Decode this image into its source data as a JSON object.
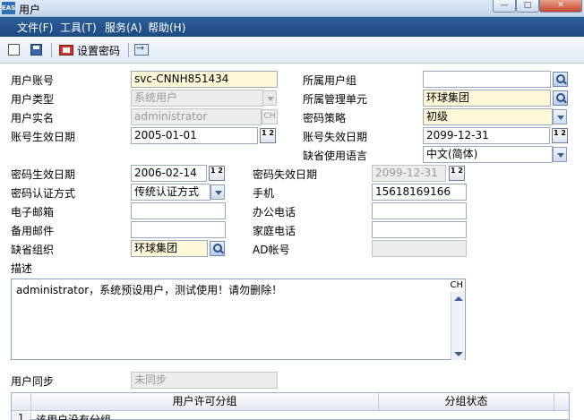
{
  "window": {
    "title": "用户",
    "logo": "EAS",
    "controls": {
      "minimize": "—",
      "maximize": "□",
      "close": "✕"
    }
  },
  "menu": {
    "items": [
      "文件(F)",
      "工具(T)",
      "服务(A)",
      "帮助(H)"
    ]
  },
  "toolbar": {
    "set_password": "设置密码"
  },
  "form": {
    "user_account": {
      "label": "用户账号",
      "value": "svc-CNNH851434"
    },
    "user_type": {
      "label": "用户类型",
      "value": "系统用户"
    },
    "real_name": {
      "label": "用户实名",
      "value": "administrator",
      "ch": "CH"
    },
    "account_effective": {
      "label": "账号生效日期",
      "value": "2005-01-01"
    },
    "user_group": {
      "label": "所属用户组",
      "value": ""
    },
    "admin_unit": {
      "label": "所属管理单元",
      "value": "环球集团"
    },
    "password_policy": {
      "label": "密码策略",
      "value": "初级"
    },
    "account_expire": {
      "label": "账号失效日期",
      "value": "2099-12-31"
    },
    "default_language": {
      "label": "缺省使用语言",
      "value": "中文(简体)"
    },
    "pwd_effective": {
      "label": "密码生效日期",
      "value": "2006-02-14"
    },
    "pwd_auth": {
      "label": "密码认证方式",
      "value": "传统认证方式"
    },
    "email": {
      "label": "电子邮箱",
      "value": ""
    },
    "backup_email": {
      "label": "备用邮件",
      "value": ""
    },
    "default_org": {
      "label": "缺省组织",
      "value": "环球集团"
    },
    "pwd_expire": {
      "label": "密码失效日期",
      "value": "2099-12-31"
    },
    "mobile": {
      "label": "手机",
      "value": "15618169166"
    },
    "office_phone": {
      "label": "办公电话",
      "value": ""
    },
    "home_phone": {
      "label": "家庭电话",
      "value": ""
    },
    "ad_account": {
      "label": "AD帐号",
      "value": ""
    },
    "description": {
      "label": "描述",
      "value": "administrator，系统预设用户，测试使用！请勿删除！",
      "ch": "CH"
    },
    "user_sync": {
      "label": "用户同步",
      "value": "未同步"
    },
    "calendar_glyph": "1 2"
  },
  "license_grid": {
    "columns": [
      "用户许可分组",
      "分组状态"
    ],
    "rows": [
      {
        "num": "1",
        "text": "该用户没有分组"
      }
    ]
  }
}
